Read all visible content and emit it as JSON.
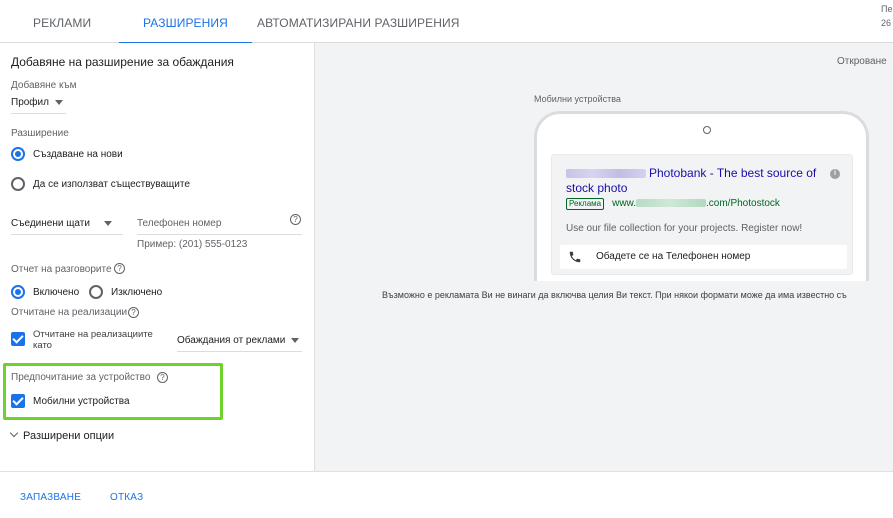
{
  "tabs": [
    {
      "label": "РЕКЛАМИ",
      "active": false
    },
    {
      "label": "РАЗШИРЕНИЯ",
      "active": true
    },
    {
      "label": "АВТОМАТИЗИРАНИ РАЗШИРЕНИЯ",
      "active": false
    }
  ],
  "corner": {
    "top": "Пе",
    "bottom": "26"
  },
  "form": {
    "title": "Добавяне на разширение за обаждания",
    "add_to_label": "Добавяне към",
    "add_to_value": "Профил",
    "extension_label": "Разширение",
    "radio_new": "Създаване на нови",
    "radio_existing": "Да се използват съществуващите",
    "country_value": "Съединени щати",
    "phone_placeholder": "Телефонен номер",
    "phone_example": "Пример: (201) 555-0123",
    "call_report_label": "Отчет на разговорите",
    "call_report_on": "Включено",
    "call_report_off": "Изключено",
    "conversion_label": "Отчитане на реализации",
    "conversion_checkbox_line1": "Отчитане на реализациите",
    "conversion_checkbox_line2": "като",
    "conversion_value": "Обаждания от реклами",
    "device_pref_label": "Предпочитание за устройство",
    "device_mobile": "Мобилни устройства",
    "advanced_options": "Разширени опции"
  },
  "preview": {
    "open_link": "Откроване",
    "device_label": "Мобилни устройства",
    "ad": {
      "title": "Photobank - The best source of stock photo",
      "badge": "Реклама",
      "url_prefix": "www.",
      "url_suffix": ".com/Photostock",
      "description": "Use our file collection for your projects. Register now!",
      "call_text": "Обадете се на Телефонен номер"
    },
    "disclaimer": "Възможно е рекламата Ви не винаги да включва целия Ви текст. При някои формати може да има известно съ"
  },
  "footer": {
    "save": "ЗАПАЗВАНЕ",
    "cancel": "ОТКАЗ"
  },
  "colors": {
    "accent": "#1a73e8",
    "highlight": "#6dd32c",
    "ad_url": "#006621",
    "ad_title": "#1a0dab"
  }
}
